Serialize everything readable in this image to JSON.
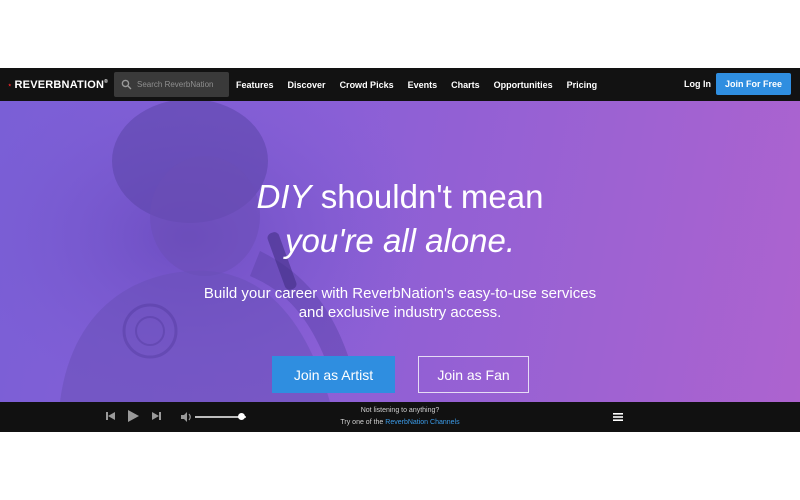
{
  "brand": {
    "name": "REVERBNATION",
    "tm": "®",
    "star_color": "#e4262a"
  },
  "search": {
    "placeholder": "Search ReverbNation"
  },
  "nav": {
    "items": [
      {
        "label": "Features"
      },
      {
        "label": "Discover"
      },
      {
        "label": "Crowd Picks"
      },
      {
        "label": "Events"
      },
      {
        "label": "Charts"
      },
      {
        "label": "Opportunities"
      },
      {
        "label": "Pricing"
      }
    ],
    "login_label": "Log In",
    "join_label": "Join For Free"
  },
  "hero": {
    "line1_italic": "DIY",
    "line1_rest": " shouldn't mean",
    "line2_italic": "you're all alone.",
    "subtitle_line1": "Build your career with ReverbNation's easy-to-use services",
    "subtitle_line2": "and exclusive industry access.",
    "artist_button": "Join as Artist",
    "fan_button": "Join as Fan"
  },
  "player": {
    "status_line1": "Not listening to anything?",
    "status_line2_prefix": "Try one of the ",
    "status_link": "ReverbNation Channels",
    "volume_level": 0.92,
    "icons": [
      "previous-icon",
      "play-icon",
      "next-icon",
      "volume-icon",
      "menu-icon"
    ]
  },
  "colors": {
    "accent": "#2f8ee0",
    "nav_bg": "#121212",
    "hero_purple": "#8a5fd6",
    "link": "#3b9be8"
  }
}
